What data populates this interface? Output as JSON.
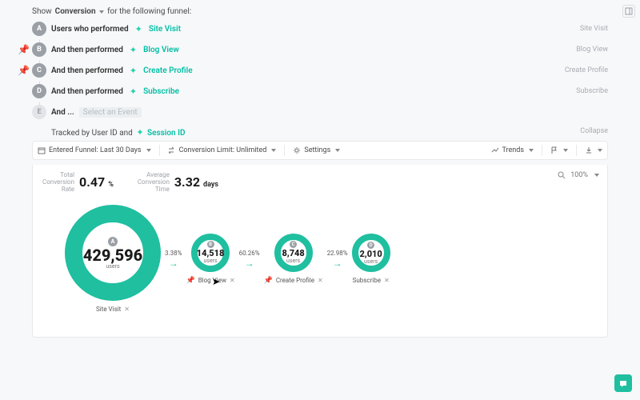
{
  "header": {
    "show": "Show",
    "conversion": "Conversion",
    "suffix": "for the following funnel:"
  },
  "steps": {
    "a": {
      "letter": "A",
      "text": "Users who performed",
      "event": "Site Visit",
      "right": "Site Visit"
    },
    "b": {
      "letter": "B",
      "text": "And then performed",
      "event": "Blog View",
      "right": "Blog View"
    },
    "c": {
      "letter": "C",
      "text": "And then performed",
      "event": "Create Profile",
      "right": "Create Profile"
    },
    "d": {
      "letter": "D",
      "text": "And then performed",
      "event": "Subscribe",
      "right": "Subscribe"
    },
    "e": {
      "letter": "E",
      "text": "And ...",
      "placeholder": "Select an Event"
    }
  },
  "tracked": {
    "prefix": "Tracked by User ID and",
    "session": "Session ID"
  },
  "collapse": "Collapse",
  "bar": {
    "range": "Entered Funnel: Last 30 Days",
    "limit": "Conversion Limit: Unlimited",
    "settings": "Settings",
    "trends": "Trends"
  },
  "stats": {
    "rate_lbl1": "Total",
    "rate_lbl2": "Conversion",
    "rate_lbl3": "Rate",
    "rate_val": "0.47",
    "rate_unit": "%",
    "time_lbl1": "Average",
    "time_lbl2": "Conversion",
    "time_lbl3": "Time",
    "time_val": "3.32",
    "time_unit": "days"
  },
  "zoom": {
    "pct": "100%"
  },
  "nodes": {
    "a": {
      "tag": "A",
      "num": "429,596",
      "usr": "users",
      "cap": "Site Visit"
    },
    "b": {
      "tag": "B",
      "num": "14,518",
      "usr": "users",
      "cap": "Blog View"
    },
    "c": {
      "tag": "C",
      "num": "8,748",
      "usr": "users",
      "cap": "Create Profile"
    },
    "d": {
      "tag": "D",
      "num": "2,010",
      "usr": "users",
      "cap": "Subscribe"
    }
  },
  "pcts": {
    "ab": "3.38%",
    "bc": "60.26%",
    "cd": "22.98%"
  },
  "chart_data": {
    "type": "funnel",
    "steps": [
      {
        "label": "Site Visit",
        "users": 429596
      },
      {
        "label": "Blog View",
        "users": 14518
      },
      {
        "label": "Create Profile",
        "users": 8748
      },
      {
        "label": "Subscribe",
        "users": 2010
      }
    ],
    "conversion_rates": [
      3.38,
      60.26,
      22.98
    ],
    "total_conversion_rate_pct": 0.47,
    "avg_conversion_time_days": 3.32
  }
}
